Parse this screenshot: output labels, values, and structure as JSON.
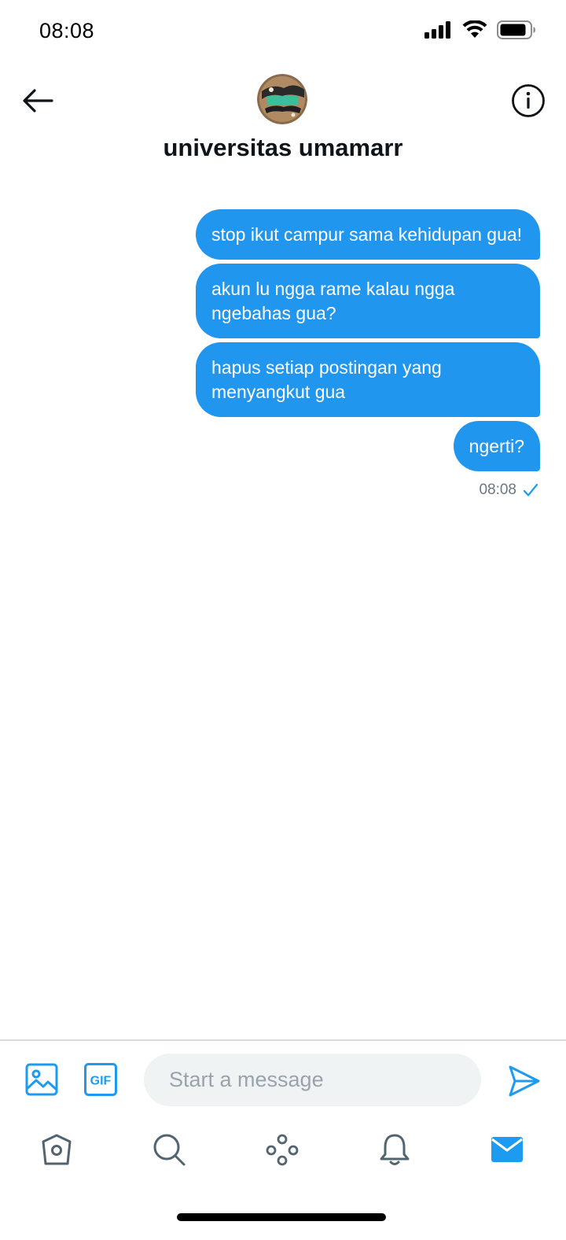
{
  "status_bar": {
    "time": "08:08"
  },
  "header": {
    "contact_name": "universitas umamarr"
  },
  "messages": [
    {
      "text": "stop ikut campur sama kehidupan gua!"
    },
    {
      "text": "akun lu ngga rame kalau ngga ngebahas gua?"
    },
    {
      "text": "hapus setiap postingan yang menyangkut gua"
    },
    {
      "text": "ngerti?"
    }
  ],
  "last_message_time": "08:08",
  "composer": {
    "placeholder": "Start a message",
    "gif_label": "GIF"
  },
  "colors": {
    "accent": "#1d9bf0",
    "bubble": "#2196ef"
  },
  "icons": {
    "header": [
      "back-arrow-icon",
      "info-icon"
    ],
    "composer": [
      "image-icon",
      "gif-icon",
      "send-icon"
    ],
    "tabs": [
      "home-icon",
      "search-icon",
      "spaces-icon",
      "notifications-icon",
      "messages-icon"
    ]
  },
  "active_tab": "messages"
}
